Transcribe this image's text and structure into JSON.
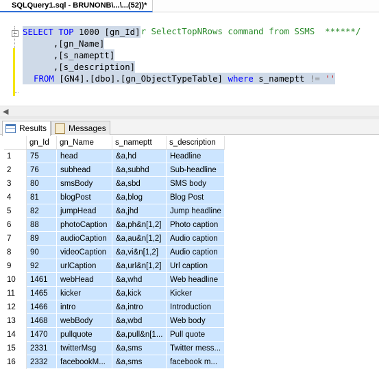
{
  "tab": {
    "title": "SQLQuery1.sql - BRUNONB\\...\\...(52))*"
  },
  "code": {
    "line1": "/****** Script for SelectTopNRows command from SSMS  ******/",
    "line2_kw1": "SELECT",
    "line2_kw2": "TOP",
    "line2_rest": " 1000 [gn_Id]",
    "line3": "      ,[gn_Name]",
    "line4": "      ,[s_nameptt]",
    "line5": "      ,[s_description]",
    "line6_kw": "FROM",
    "line6_mid": " [GN4].[dbo].[gn_ObjectTypeTable] ",
    "line6_where": "where",
    "line6_col": " s_nameptt ",
    "line6_op": "!=",
    "line6_str": "''"
  },
  "results_tabs": {
    "results": "Results",
    "messages": "Messages"
  },
  "grid": {
    "headers": [
      "gn_Id",
      "gn_Name",
      "s_nameptt",
      "s_description"
    ],
    "rows": [
      [
        "1",
        "75",
        "head",
        "&a,hd",
        "Headline"
      ],
      [
        "2",
        "76",
        "subhead",
        "&a,subhd",
        "Sub-headline"
      ],
      [
        "3",
        "80",
        "smsBody",
        "&a,sbd",
        "SMS body"
      ],
      [
        "4",
        "81",
        "blogPost",
        "&a,blog",
        "Blog Post"
      ],
      [
        "5",
        "82",
        "jumpHead",
        "&a,jhd",
        "Jump headline"
      ],
      [
        "6",
        "88",
        "photoCaption",
        "&a,ph&n[1,2]",
        "Photo caption"
      ],
      [
        "7",
        "89",
        "audioCaption",
        "&a,au&n[1,2]",
        "Audio caption"
      ],
      [
        "8",
        "90",
        "videoCaption",
        "&a,vi&n[1,2]",
        "Audio caption"
      ],
      [
        "9",
        "92",
        "urlCaption",
        "&a,url&n[1,2]",
        "Url caption"
      ],
      [
        "10",
        "1461",
        "webHead",
        "&a,whd",
        "Web headline"
      ],
      [
        "11",
        "1465",
        "kicker",
        "&a,kick",
        "Kicker"
      ],
      [
        "12",
        "1466",
        "intro",
        "&a,intro",
        "Introduction"
      ],
      [
        "13",
        "1468",
        "webBody",
        "&a,wbd",
        "Web body"
      ],
      [
        "14",
        "1470",
        "pullquote",
        "&a,pull&n[1...",
        "Pull quote"
      ],
      [
        "15",
        "2331",
        "twitterMsg",
        "&a,sms",
        "Twitter mess..."
      ],
      [
        "16",
        "2332",
        "facebookM...",
        "&a,sms",
        "facebook m..."
      ]
    ]
  },
  "colors": {
    "selection": "#cfdae8",
    "comment": "#2a8a2a",
    "keyword": "#0000ff",
    "string": "#c81e1e",
    "cell": "#cce5ff"
  },
  "icons": {
    "results": "grid-icon",
    "messages": "messages-icon",
    "collapse": "collapse-minus-icon",
    "scroll_left": "arrow-left-icon"
  }
}
